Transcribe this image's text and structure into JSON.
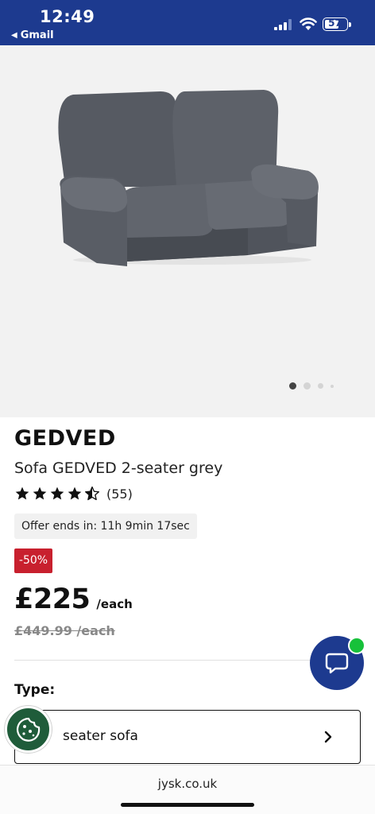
{
  "status_bar": {
    "time": "12:49",
    "back_app": "Gmail",
    "battery": "57",
    "icons": [
      "signal-icon",
      "wifi-icon",
      "battery-icon"
    ]
  },
  "gallery": {
    "image": "sofa-image",
    "active_index": 0,
    "dot_count": 4
  },
  "product": {
    "brand": "GEDVED",
    "name": "Sofa GEDVED 2-seater grey",
    "rating": 4.5,
    "review_count": "(55)",
    "offer": "Offer ends in: 11h 9min 17sec",
    "discount": "-50%",
    "price": "£225",
    "price_unit": "/each",
    "old_price": "£449.99 /each"
  },
  "type_selector": {
    "label": "Type:",
    "value": "seater sofa"
  },
  "floating": {
    "chat_icon": "chat-icon",
    "cookie_icon": "cookie-icon"
  },
  "browser": {
    "url": "jysk.co.uk"
  },
  "colors": {
    "header": "#1d3a8f",
    "discount": "#c8202e",
    "online": "#17c13a",
    "cookie": "#1f5c3a"
  }
}
